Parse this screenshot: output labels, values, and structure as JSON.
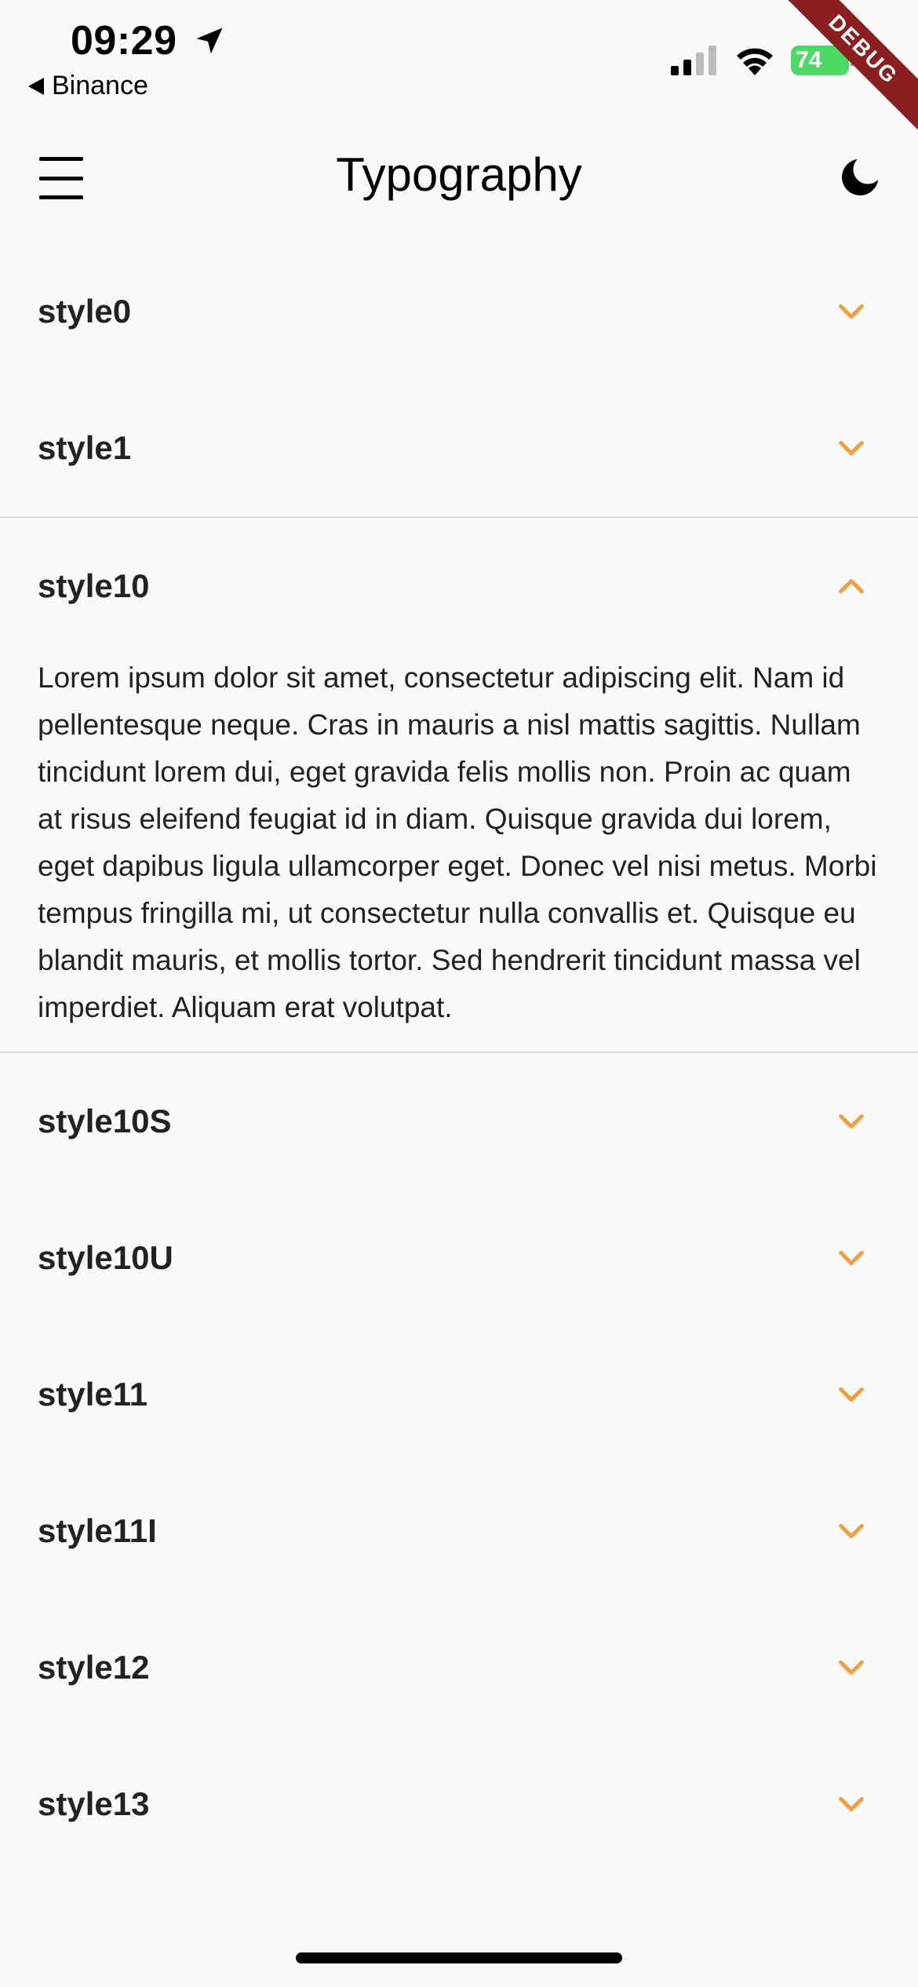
{
  "status_bar": {
    "time": "09:29",
    "back_app": "Binance",
    "battery_level": "74",
    "debug_label": "DEBUG",
    "icons": [
      "location-arrow-icon",
      "signal-icon",
      "wifi-icon",
      "battery-charging-icon"
    ]
  },
  "app_bar": {
    "title": "Typography",
    "menu_icon": "hamburger-menu-icon",
    "theme_icon": "moon-icon"
  },
  "colors": {
    "background": "#fafafa",
    "accent": "#f0a03c",
    "text": "#222222",
    "divider": "#dcdcdc",
    "debug_banner": "#8b1e1e",
    "battery": "#4cd964"
  },
  "tiles": [
    {
      "title": "style0",
      "expanded": false
    },
    {
      "title": "style1",
      "expanded": false
    },
    {
      "title": "style10",
      "expanded": true,
      "body": "Lorem ipsum dolor sit amet, consectetur adipiscing elit. Nam id pellentesque neque. Cras in mauris a nisl mattis sagittis. Nullam tincidunt lorem dui, eget gravida felis mollis non. Proin ac quam at risus eleifend feugiat id in diam. Quisque gravida dui lorem, eget dapibus ligula ullamcorper eget. Donec vel nisi metus. Morbi tempus fringilla mi, ut consectetur nulla convallis et. Quisque eu blandit mauris, et mollis tortor. Sed hendrerit tincidunt massa vel imperdiet. Aliquam erat volutpat."
    },
    {
      "title": "style10S",
      "expanded": false
    },
    {
      "title": "style10U",
      "expanded": false
    },
    {
      "title": "style11",
      "expanded": false
    },
    {
      "title": "style11I",
      "expanded": false
    },
    {
      "title": "style12",
      "expanded": false
    },
    {
      "title": "style13",
      "expanded": false
    }
  ]
}
